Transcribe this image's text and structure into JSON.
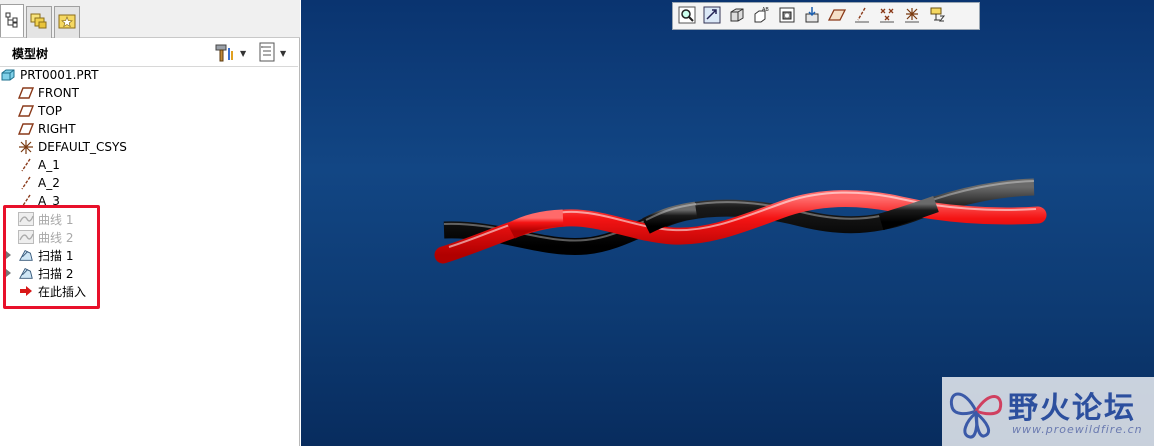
{
  "sidebar": {
    "tabs": [
      {
        "icon": "model-tree-icon"
      },
      {
        "icon": "folder-browser-icon"
      },
      {
        "icon": "favorites-icon"
      }
    ],
    "title": "模型树",
    "settings_icon": "settings-hammer-icon",
    "show_icon": "show-list-icon"
  },
  "tree": {
    "root": "PRT0001.PRT",
    "items": [
      {
        "label": "FRONT",
        "icon": "datum-plane-icon",
        "state": "normal"
      },
      {
        "label": "TOP",
        "icon": "datum-plane-icon",
        "state": "normal"
      },
      {
        "label": "RIGHT",
        "icon": "datum-plane-icon",
        "state": "normal"
      },
      {
        "label": "DEFAULT_CSYS",
        "icon": "csys-icon",
        "state": "normal"
      },
      {
        "label": "A_1",
        "icon": "datum-axis-icon",
        "state": "normal"
      },
      {
        "label": "A_2",
        "icon": "datum-axis-icon",
        "state": "normal"
      },
      {
        "label": "A_3",
        "icon": "datum-axis-icon",
        "state": "normal"
      },
      {
        "label": "曲线 1",
        "icon": "curve-icon",
        "state": "suppressed"
      },
      {
        "label": "曲线 2",
        "icon": "curve-icon",
        "state": "suppressed"
      },
      {
        "label": "扫描 1",
        "icon": "sweep-icon",
        "state": "normal",
        "expandable": true
      },
      {
        "label": "扫描 2",
        "icon": "sweep-icon",
        "state": "normal",
        "expandable": true
      },
      {
        "label": "在此插入",
        "icon": "insert-here-arrow-icon",
        "state": "normal"
      }
    ]
  },
  "viewport_toolbar": [
    "zoom-window-icon",
    "refit-icon",
    "display-style-icon",
    "saved-views-icon",
    "view-manager-icon",
    "spin-center-icon",
    "plane-display-icon",
    "axis-display-icon",
    "point-display-icon",
    "csys-display-icon",
    "annotation-display-icon"
  ],
  "colors": {
    "viewport_top": "#0a3470",
    "viewport_bottom": "#082c5e",
    "wire_red": "#ee1010",
    "wire_black": "#111111",
    "highlight": "#e8102a"
  },
  "watermark": {
    "title": "野火论坛",
    "url": "www.proewildfire.cn"
  }
}
